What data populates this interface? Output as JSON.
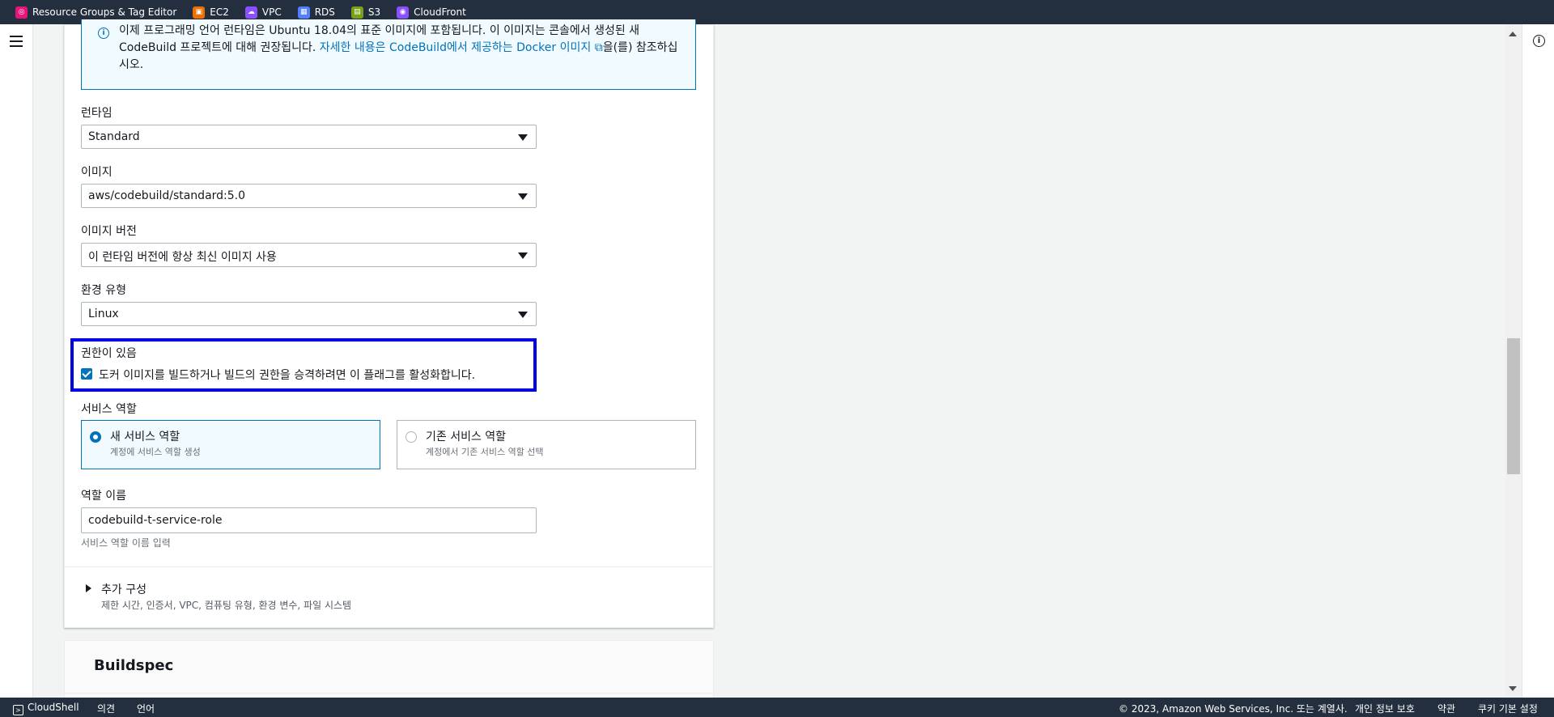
{
  "favorites": [
    {
      "label": "Resource Groups & Tag Editor",
      "icon": "resource-groups-icon",
      "color": "#e7157b"
    },
    {
      "label": "EC2",
      "icon": "ec2-icon",
      "color": "#ed7100"
    },
    {
      "label": "VPC",
      "icon": "vpc-icon",
      "color": "#8c4fff"
    },
    {
      "label": "RDS",
      "icon": "rds-icon",
      "color": "#527fff"
    },
    {
      "label": "S3",
      "icon": "s3-icon",
      "color": "#7aa116"
    },
    {
      "label": "CloudFront",
      "icon": "cloudfront-icon",
      "color": "#8c4fff"
    }
  ],
  "alert": {
    "text": "이제 프로그래밍 언어 런타임은 Ubuntu 18.04의 표준 이미지에 포함됩니다. 이 이미지는 콘솔에서 생성된 새 CodeBuild 프로젝트에 대해 권장됩니다. ",
    "link": "자세한 내용은 CodeBuild에서 제공하는 Docker 이미지",
    "suffix": "을(를) 참조하십시오."
  },
  "runtime": {
    "label": "런타임",
    "value": "Standard"
  },
  "image": {
    "label": "이미지",
    "value": "aws/codebuild/standard:5.0"
  },
  "image_version": {
    "label": "이미지 버전",
    "value": "이 런타임 버전에 항상 최신 이미지 사용"
  },
  "environment_type": {
    "label": "환경 유형",
    "value": "Linux"
  },
  "privileged": {
    "label": "권한이 있음",
    "checkbox_label": "도커 이미지를 빌드하거나 빌드의 권한을 승격하려면 이 플래그를 활성화합니다.",
    "checked": true
  },
  "service_role": {
    "label": "서비스 역할",
    "options": [
      {
        "title": "새 서비스 역할",
        "desc": "계정에 서비스 역할 생성",
        "selected": true
      },
      {
        "title": "기존 서비스 역할",
        "desc": "계정에서 기존 서비스 역할 선택",
        "selected": false
      }
    ]
  },
  "role_name": {
    "label": "역할 이름",
    "value": "codebuild-t-service-role",
    "hint": "서비스 역할 이름 입력"
  },
  "additional_config": {
    "title": "추가 구성",
    "desc": "제한 시간, 인증서, VPC, 컴퓨팅 유형, 환경 변수, 파일 시스템"
  },
  "buildspec": {
    "title": "Buildspec"
  },
  "footer": {
    "cloudshell": "CloudShell",
    "feedback": "의견",
    "language": "언어",
    "copyright": "© 2023, Amazon Web Services, Inc. 또는 계열사.",
    "privacy": "개인 정보 보호",
    "terms": "약관",
    "cookies": "쿠키 기본 설정"
  }
}
